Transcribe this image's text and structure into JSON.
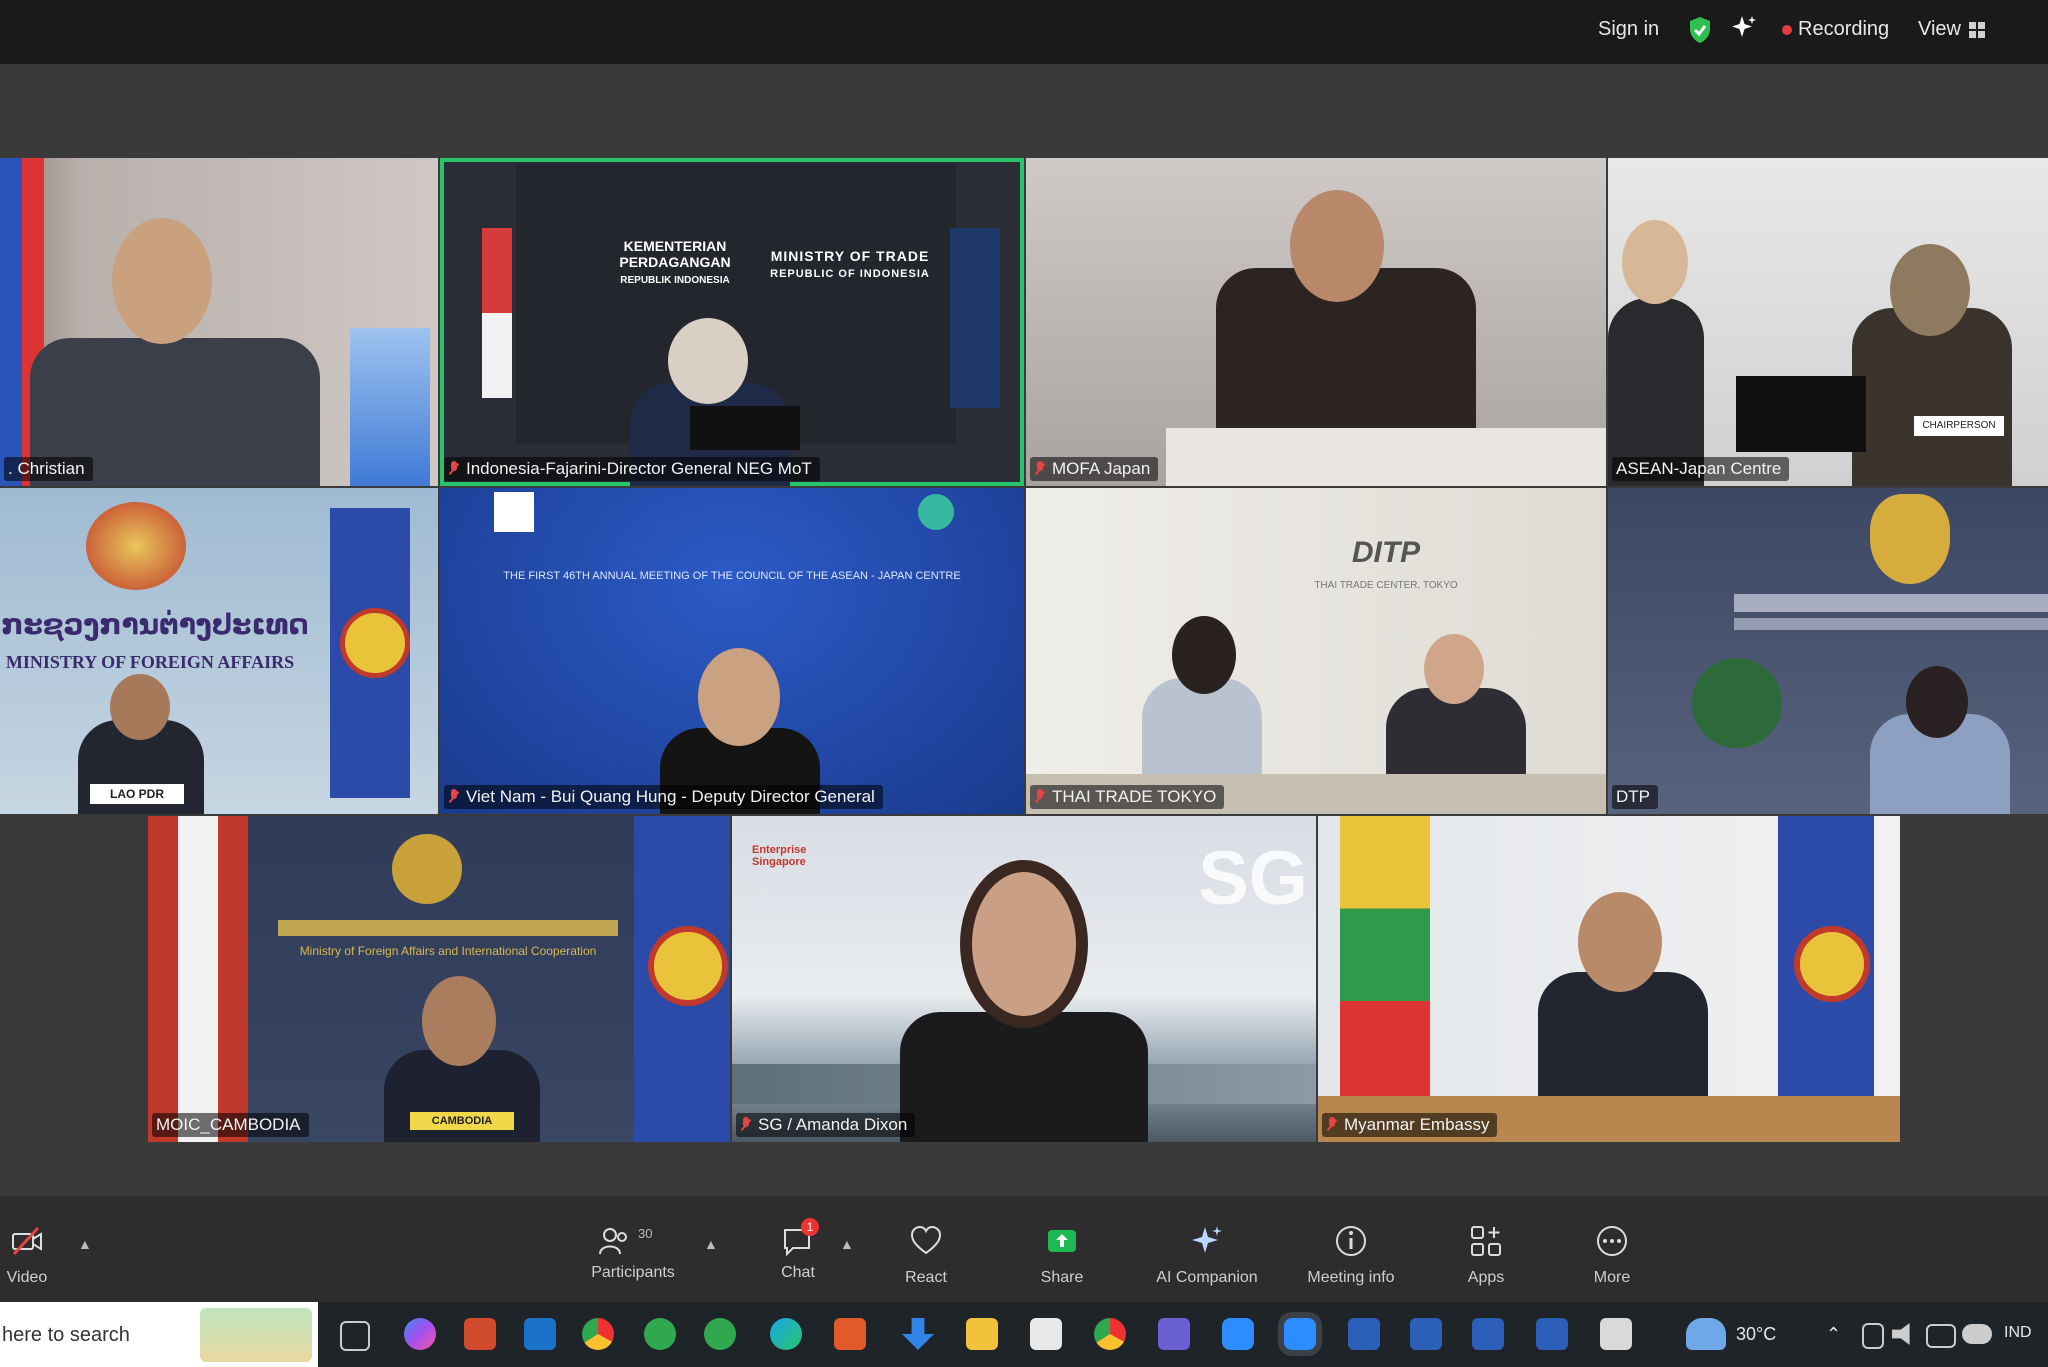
{
  "topbar": {
    "sign_in": "Sign in",
    "recording": "Recording",
    "view": "View",
    "colors": {
      "shield": "#2fbf4f",
      "recording_dot": "#e23b3b"
    }
  },
  "tiles": [
    {
      "name": ". Christian",
      "muted": false
    },
    {
      "name": "Indonesia-Fajarini-Director General NEG MoT",
      "muted": true,
      "active": true,
      "sign_top": "KEMENTERIAN PERDAGANGAN",
      "sign_sub": "REPUBLIK INDONESIA",
      "sign_right": "MINISTRY OF TRADE",
      "sign_right_sub": "REPUBLIC OF INDONESIA"
    },
    {
      "name": "MOFA Japan",
      "muted": true
    },
    {
      "name": "ASEAN-Japan Centre",
      "muted": false,
      "desk_label": "CHAIRPERSON"
    },
    {
      "name": "LAO PDR",
      "muted": false,
      "sign_lao": "ກະຊວງການຕ່າງປະເທດ",
      "sign_en": "MINISTRY OF FOREIGN AFFAIRS"
    },
    {
      "name": "Viet Nam - Bui Quang Hung - Deputy Director General",
      "muted": true,
      "banner": "THE FIRST 46TH ANNUAL MEETING OF THE COUNCIL OF THE ASEAN - JAPAN CENTRE"
    },
    {
      "name": "THAI TRADE TOKYO",
      "muted": true,
      "logo": "DITP",
      "logo_sub": "THAI TRADE CENTER, TOKYO"
    },
    {
      "name": "DTP",
      "muted": false
    },
    {
      "name": "MOIC_CAMBODIA",
      "muted": false,
      "sign_en": "Ministry of Foreign Affairs and International Cooperation",
      "desk_label": "CAMBODIA"
    },
    {
      "name": "SG / Amanda Dixon",
      "muted": true,
      "logo": "SG",
      "logo_sub": "Enterprise Singapore"
    },
    {
      "name": "Myanmar Embassy",
      "muted": true
    }
  ],
  "toolbar": {
    "video": "Video",
    "participants": "Participants",
    "participants_count": "30",
    "chat": "Chat",
    "chat_badge": "1",
    "react": "React",
    "share": "Share",
    "ai_companion": "AI Companion",
    "meeting_info": "Meeting info",
    "apps": "Apps",
    "more": "More",
    "colors": {
      "share": "#1fb954"
    }
  },
  "taskbar": {
    "search_placeholder": "here to search",
    "temperature": "30°C",
    "language": "IND"
  }
}
